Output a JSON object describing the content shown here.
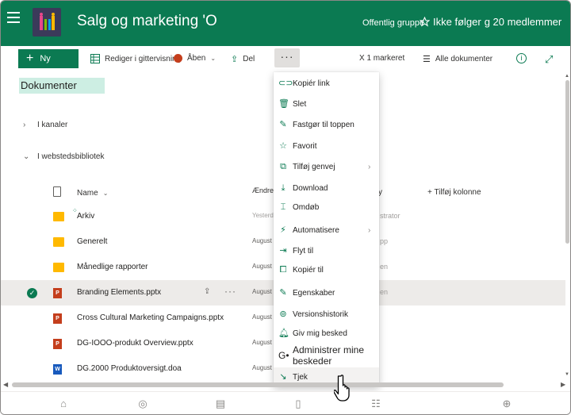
{
  "header": {
    "title": "Salg og marketing 'O",
    "group_type": "Offentlig gruppe",
    "follow_label": "Ikke følger",
    "member_count": "g 20 medlemmer"
  },
  "commandbar": {
    "new_label": "Ny",
    "grid_edit_label": "Rediger i gittervisning",
    "open_label": "Åben",
    "share_label": "Del",
    "more_label": "···",
    "selection_label": "X 1 markeret",
    "view_label": "Alle dokumenter"
  },
  "breadcrumb": {
    "title": "Dokumenter"
  },
  "groups": [
    {
      "label": "I kanaler"
    },
    {
      "label": "I webstedsbibliotek"
    }
  ],
  "columns": {
    "name": "Name",
    "modified": "Ændre",
    "modified_by": "y",
    "add_column": "+ Tilføj kolonne"
  },
  "rows": [
    {
      "name": "Arkiv",
      "date": "Yesterd",
      "by": "strator",
      "icon": "folder"
    },
    {
      "name": "Generelt",
      "date": "August",
      "by": "pp",
      "icon": "folder"
    },
    {
      "name": "Månedlige rapporter",
      "date": "August",
      "by": "en",
      "icon": "folder"
    },
    {
      "name": "Branding Elements.pptx",
      "date": "August",
      "by": "en",
      "icon": "pptx"
    },
    {
      "name": "Cross Cultural Marketing Campaigns.pptx",
      "date": "August",
      "by": "",
      "icon": "pptx"
    },
    {
      "name": "DG-IOOO-produkt Overview.pptx",
      "date": "August",
      "by": "",
      "icon": "pptx"
    },
    {
      "name": "DG.2000 Produktoversigt.doa",
      "date": "August",
      "by": "",
      "icon": "docx"
    }
  ],
  "menu": {
    "items": [
      {
        "label": "Kopiér link",
        "icon": "link-icon"
      },
      {
        "label": "Slet",
        "icon": "trash-icon"
      },
      {
        "label": "Fastgør til toppen",
        "icon": "pin-icon"
      },
      {
        "label": "Favorit",
        "icon": "star-icon"
      },
      {
        "label": "Tilføj genvej",
        "icon": "shortcut-icon"
      },
      {
        "label": "Download",
        "icon": "download-icon"
      },
      {
        "label": "Omdøb",
        "icon": "rename-icon"
      },
      {
        "label": "Automatisere",
        "icon": "automate-icon"
      },
      {
        "label": "Flyt til",
        "icon": "move-icon"
      },
      {
        "label": "Kopiér til",
        "icon": "copy-icon"
      },
      {
        "label": "Egenskaber",
        "icon": "edit-icon"
      },
      {
        "label": "Versionshistorik",
        "icon": "history-icon"
      },
      {
        "label": "Giv mig besked",
        "icon": "bell-icon"
      },
      {
        "label": "Administrer mine beskeder",
        "icon": "manage-alerts-icon"
      },
      {
        "label": "Tjek",
        "icon": "checkout-icon"
      }
    ]
  },
  "colors": {
    "brand": "#0b7a52",
    "selection": "#edebe9",
    "breadcrumb_highlight": "#cdeee3"
  }
}
